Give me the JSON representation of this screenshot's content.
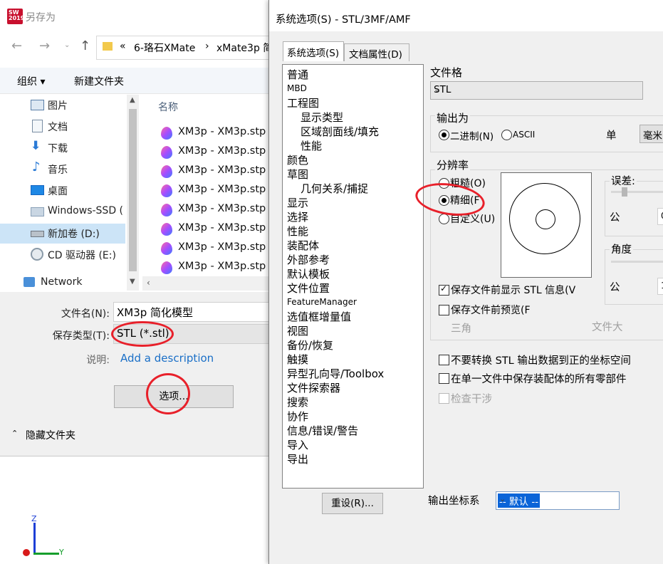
{
  "saveas": {
    "title": "另存为",
    "address": {
      "prefix": "«",
      "crumb1": "6-珞石XMate",
      "sep": "›",
      "crumb2": "xMate3p 简"
    },
    "toolbar": {
      "organize": "组织 ▾",
      "new_folder": "新建文件夹"
    },
    "sidebar": [
      {
        "label": "图片",
        "icon": "pictures-icon"
      },
      {
        "label": "文档",
        "icon": "documents-icon"
      },
      {
        "label": "下载",
        "icon": "download-icon"
      },
      {
        "label": "音乐",
        "icon": "music-icon"
      },
      {
        "label": "桌面",
        "icon": "desktop-icon"
      },
      {
        "label": "Windows-SSD (",
        "icon": "windows-drive-icon"
      },
      {
        "label": "新加卷 (D:)",
        "icon": "drive-icon"
      },
      {
        "label": "CD 驱动器 (E:)",
        "icon": "cd-drive-icon"
      },
      {
        "label": "Network",
        "icon": "network-icon"
      }
    ],
    "column_header": "名称",
    "files": [
      "XM3p - XM3p.stp",
      "XM3p - XM3p.stp",
      "XM3p - XM3p.stp",
      "XM3p - XM3p.stp",
      "XM3p - XM3p.stp",
      "XM3p - XM3p.stp",
      "XM3p - XM3p.stp",
      "XM3p - XM3p.stp"
    ],
    "filename_label": "文件名(N):",
    "filename_value": "XM3p 简化模型",
    "filetype_label": "保存类型(T):",
    "filetype_value": "STL (*.stl)",
    "desc_label": "说明:",
    "desc_link": "Add a description",
    "options_button": "选项...",
    "hide_folders": "隐藏文件夹"
  },
  "axes": {
    "z": "Z",
    "y": "Y"
  },
  "options": {
    "title": "系统选项(S) - STL/3MF/AMF",
    "tabs": [
      "系统选项(S)",
      "文档属性(D)"
    ],
    "tree": [
      "普通",
      "MBD",
      "工程图",
      "显示类型",
      "区域剖面线/填充",
      "性能",
      "颜色",
      "草图",
      "几何关系/捕捉",
      "显示",
      "选择",
      "性能",
      "装配体",
      "外部参考",
      "默认模板",
      "文件位置",
      "FeatureManager",
      "选值框增量值",
      "视图",
      "备份/恢复",
      "触摸",
      "异型孔向导/Toolbox",
      "文件探索器",
      "搜索",
      "协作",
      "信息/错误/警告",
      "导入",
      "导出"
    ],
    "reset_button": "重设(R)...",
    "format_label": "文件格",
    "format_value": "STL",
    "output_as_label": "输出为",
    "binary_label": "二进制(N)",
    "ascii_label": "ASCII",
    "unit_label": "单",
    "unit_value": "毫米",
    "resolution_label": "分辨率",
    "coarse_label": "粗糙(O)",
    "fine_label": "精细(F",
    "custom_label": "自定义(U)",
    "deviation_label": "误差:",
    "deviation_unit": "公",
    "deviation_value": "0",
    "angle_label": "角度",
    "angle_unit": "公",
    "angle_value": "1",
    "show_info_label": "保存文件前显示 STL 信息(V",
    "preview_label": "保存文件前预览(F",
    "triangles_label": "三角",
    "filesize_label": "文件大",
    "no_translate_label": "不要转换 STL 输出数据到正的坐标空间",
    "all_parts_label": "在单一文件中保存装配体的所有零部件",
    "interference_label": "检查干涉",
    "coord_label": "输出坐标系",
    "coord_value": "-- 默认 --"
  }
}
